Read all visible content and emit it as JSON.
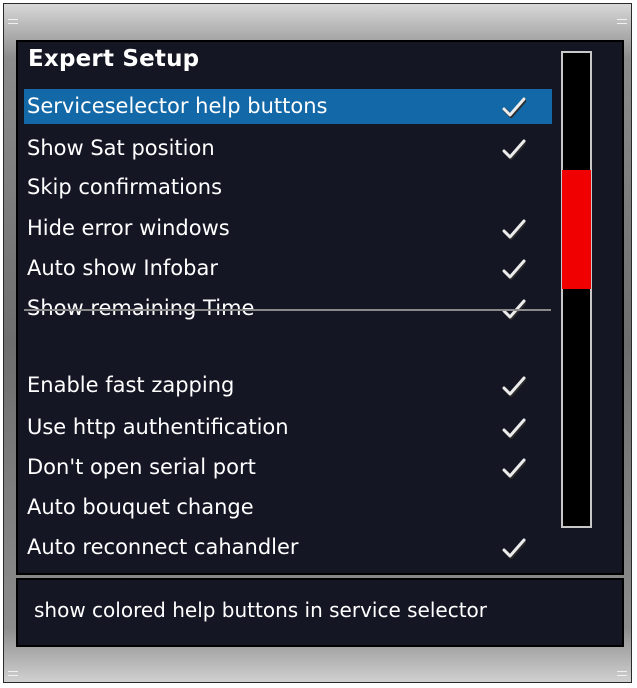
{
  "window": {
    "title": "Expert Setup"
  },
  "options": [
    {
      "label": "Serviceselector help buttons",
      "checked": true,
      "selected": true
    },
    {
      "label": "Show Sat position",
      "checked": true,
      "selected": false
    },
    {
      "label": "Skip confirmations",
      "checked": false,
      "selected": false
    },
    {
      "label": "Hide error windows",
      "checked": true,
      "selected": false
    },
    {
      "label": "Auto show Infobar",
      "checked": true,
      "selected": false
    },
    {
      "label": "Show remaining Time",
      "checked": true,
      "selected": false
    },
    {
      "label": "Enable fast zapping",
      "checked": true,
      "selected": false
    },
    {
      "label": "Use http authentification",
      "checked": true,
      "selected": false
    },
    {
      "label": "Don't open serial port",
      "checked": true,
      "selected": false
    },
    {
      "label": "Auto bouquet change",
      "checked": false,
      "selected": false
    },
    {
      "label": "Auto reconnect cahandler",
      "checked": true,
      "selected": false
    }
  ],
  "status": {
    "help_text": "show colored help buttons in service selector"
  },
  "colors": {
    "selection": "#1368a8",
    "scrollbar_thumb": "#f00000",
    "background": "#141624"
  },
  "icons": {
    "check": "checkmark-icon"
  }
}
